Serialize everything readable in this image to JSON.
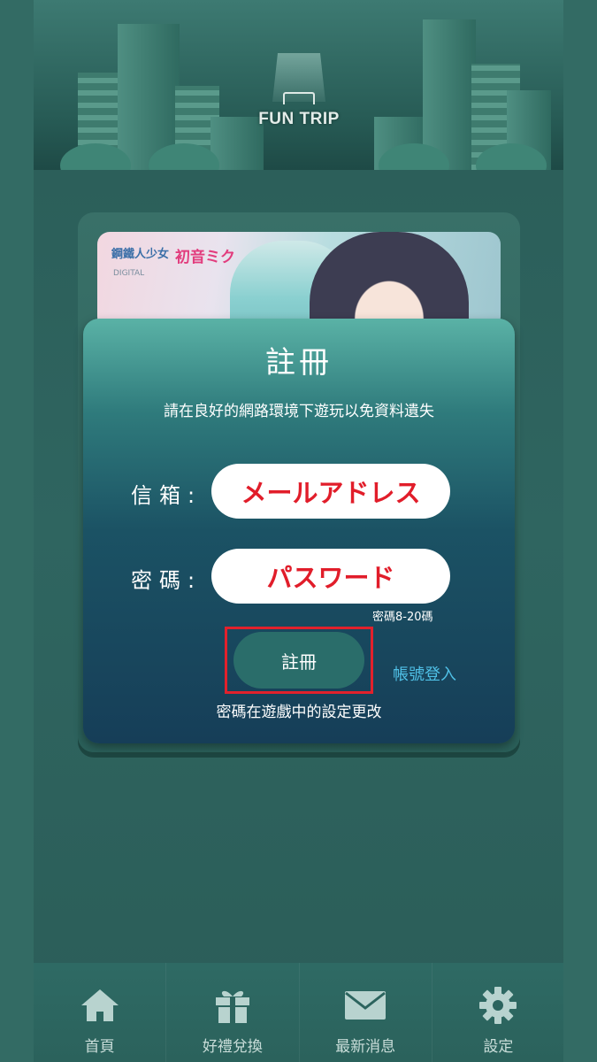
{
  "banner": {
    "logo_text": "FUN TRIP"
  },
  "card": {
    "brand_left": "鋼鐵人少女",
    "brand_right": "初音ミク",
    "brand_small": "DIGITAL"
  },
  "modal": {
    "title": "註冊",
    "subtitle": "請在良好的網路環境下遊玩以免資料遺失",
    "email_label": "信箱:",
    "email_value": "メールアドレス",
    "password_label": "密碼:",
    "password_value": "パスワード",
    "password_hint": "密碼8-20碼",
    "register_button": "註冊",
    "login_link": "帳號登入",
    "note": "密碼在遊戲中的設定更改"
  },
  "navbar": {
    "items": [
      {
        "label": "首頁",
        "icon": "home-icon"
      },
      {
        "label": "好禮兌換",
        "icon": "gift-icon"
      },
      {
        "label": "最新消息",
        "icon": "mail-icon"
      },
      {
        "label": "設定",
        "icon": "gear-icon"
      }
    ]
  },
  "colors": {
    "accent_red": "#e11d2a",
    "link_blue": "#4fc0e6",
    "button_teal": "#2a6d6a"
  }
}
